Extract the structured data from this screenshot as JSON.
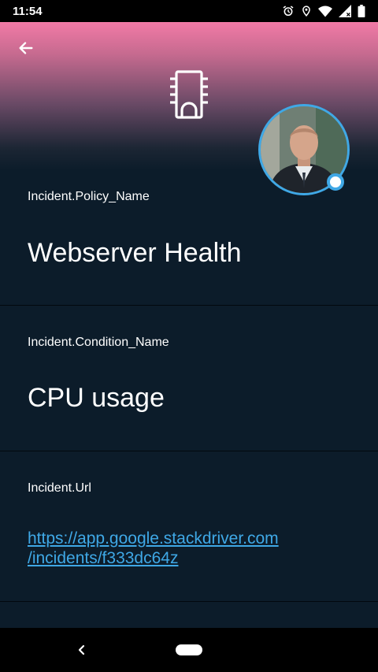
{
  "status_bar": {
    "time": "11:54",
    "icons": [
      "alarm-icon",
      "location-icon",
      "wifi-icon",
      "signal-icon",
      "battery-icon"
    ]
  },
  "header": {
    "back_icon": "arrow-back-icon",
    "hero_icon": "memory-chip-icon",
    "avatar": "user-avatar-photo"
  },
  "fields": [
    {
      "label": "Incident.Policy_Name",
      "value": "Webserver Health"
    },
    {
      "label": "Incident.Condition_Name",
      "value": "CPU usage"
    },
    {
      "label": "Incident.Url",
      "link_line1": "https://app.google.stackdriver.com",
      "link_line2": "/incidents/f333dc64z"
    }
  ],
  "nav_bar": {
    "back_icon": "nav-back-chevron-icon",
    "home_icon": "nav-home-pill-icon"
  },
  "colors": {
    "background": "#0c1c2a",
    "header_gradient_top": "#f27aa6",
    "accent": "#3fa8e6",
    "text": "#ffffff"
  }
}
